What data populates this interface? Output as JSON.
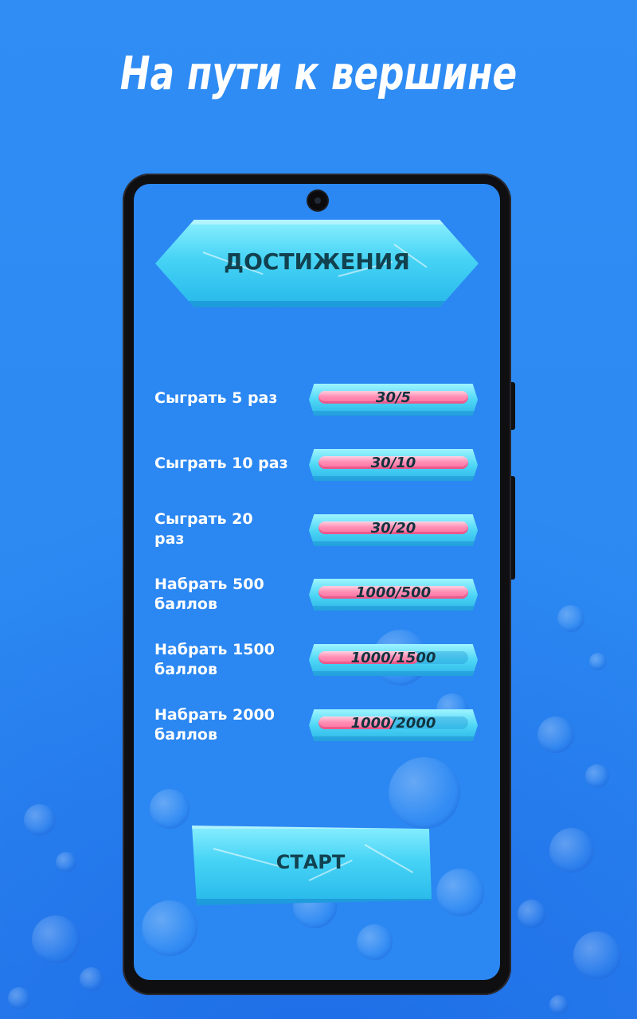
{
  "headline": "На пути к вершине",
  "achievements_title": "ДОСТИЖЕНИЯ",
  "achievements": [
    {
      "label": "Сыграть 5 раз",
      "progress": "30/5",
      "fill": 1.0
    },
    {
      "label": "Сыграть 10 раз",
      "progress": "30/10",
      "fill": 1.0
    },
    {
      "label": "Сыграть 20 раз",
      "progress": "30/20",
      "fill": 1.0
    },
    {
      "label": "Набрать 500 баллов",
      "progress": "1000/500",
      "fill": 1.0
    },
    {
      "label": "Набрать 1500 баллов",
      "progress": "1000/1500",
      "fill": 0.67
    },
    {
      "label": "Набрать 2000 баллов",
      "progress": "1000/2000",
      "fill": 0.5
    }
  ],
  "start_label": "СТАРТ",
  "colors": {
    "background": "#2f8cf3",
    "ice": "#46d3f5",
    "progress_fill": "#ff6f9e",
    "dark_text": "#12414f"
  }
}
